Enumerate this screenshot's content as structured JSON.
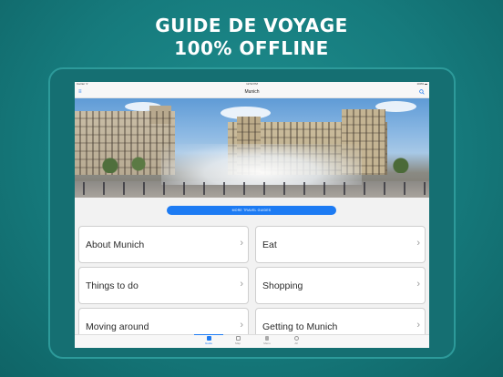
{
  "headline": {
    "line1": "GUIDE DE VOYAGE",
    "line2": "100% OFFLINE"
  },
  "statusbar": {
    "carrier": "Carrier ᯤ",
    "time": "12:52 PM",
    "battery": "100% ▬"
  },
  "navbar": {
    "title": "Munich",
    "menu_icon": "menu-icon",
    "search_icon": "search-icon"
  },
  "hero": {
    "image": "Munich Karlsplatz fountain panorama"
  },
  "more_button": {
    "label": "MORE TRAVEL GUIDES"
  },
  "tiles": [
    {
      "label": "About Munich"
    },
    {
      "label": "Eat"
    },
    {
      "label": "Things to do"
    },
    {
      "label": "Shopping"
    },
    {
      "label": "Moving around"
    },
    {
      "label": "Getting to Munich"
    }
  ],
  "tabbar": {
    "tabs": [
      {
        "label": "Guide",
        "icon": "book-icon",
        "active": true
      },
      {
        "label": "Map",
        "icon": "map-icon",
        "active": false
      },
      {
        "label": "Menu",
        "icon": "bookmark-icon",
        "active": false
      },
      {
        "label": "All",
        "icon": "globe-icon",
        "active": false
      }
    ]
  },
  "colors": {
    "accent": "#1d7bf3",
    "background": "#167b7d"
  }
}
